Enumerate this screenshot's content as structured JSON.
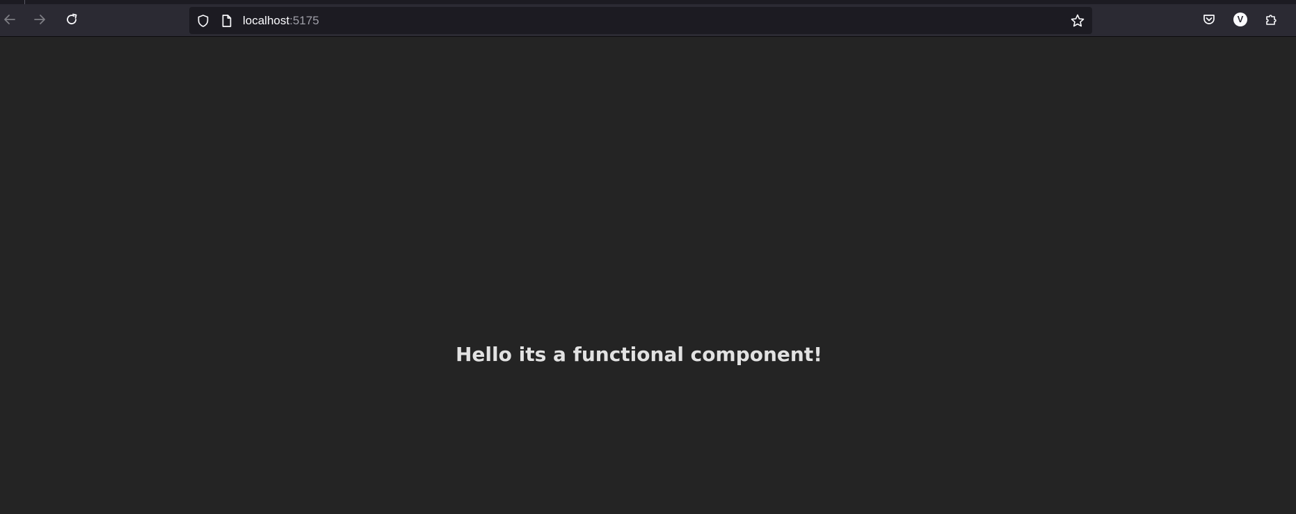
{
  "browser": {
    "toolbar": {
      "back_icon": "arrow-left-icon",
      "forward_icon": "arrow-right-icon",
      "reload_icon": "reload-icon",
      "pocket_icon": "pocket-icon",
      "account_initial": "V",
      "extensions_icon": "puzzle-icon"
    },
    "urlbar": {
      "host": "localhost",
      "port": ":5175",
      "shield_icon": "shield-icon",
      "page_icon": "page-icon",
      "bookmark_icon": "star-icon"
    }
  },
  "page": {
    "heading": "Hello its a functional component!"
  },
  "colors": {
    "page_background": "#242424",
    "toolbar_background": "#2b2a33",
    "urlbar_background": "#1c1b22",
    "heading_text": "#dedede"
  }
}
